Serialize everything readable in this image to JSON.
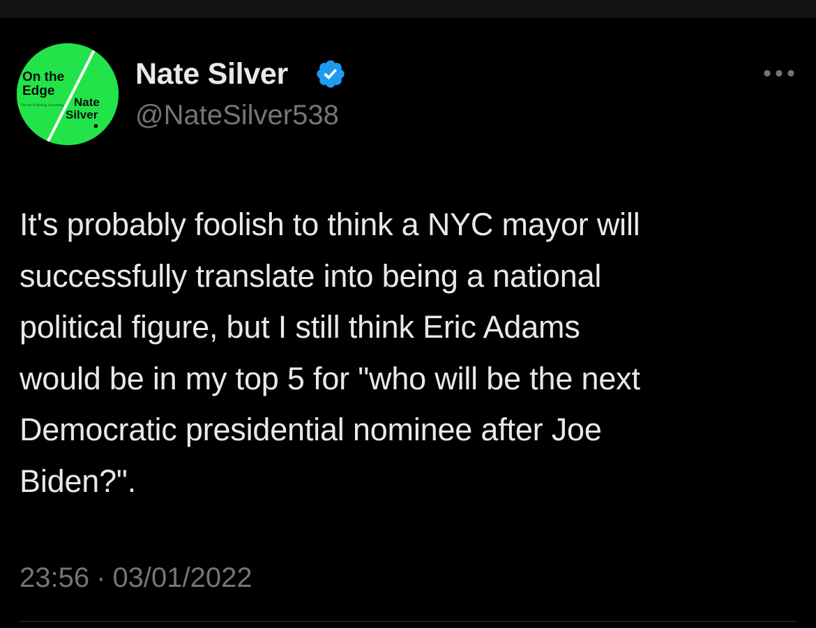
{
  "colors": {
    "background": "#000000",
    "text_primary": "#e7e9ea",
    "text_secondary": "#71767b",
    "avatar_green": "#22e44a",
    "verified_blue": "#1d9bf0",
    "divider": "#2f3336"
  },
  "author": {
    "name": "Nate Silver",
    "handle": "@NateSilver538",
    "verified_icon": "verified-badge-icon",
    "avatar": {
      "title_line1": "On the",
      "title_line2": "Edge",
      "subtitle": "The Art of Risking Everything",
      "author_line1": "Nate",
      "author_line2": "Silver"
    }
  },
  "menu": {
    "icon": "more-horizontal-icon"
  },
  "tweet": {
    "text": "It's probably foolish to think a NYC mayor will\nsuccessfully translate into being a national\npolitical figure, but I still think Eric Adams\nwould be in my top 5 for \"who will be the next\nDemocratic presidential nominee after Joe\nBiden?\"."
  },
  "meta": {
    "time": "23:56",
    "separator": "·",
    "date": "03/01/2022"
  }
}
